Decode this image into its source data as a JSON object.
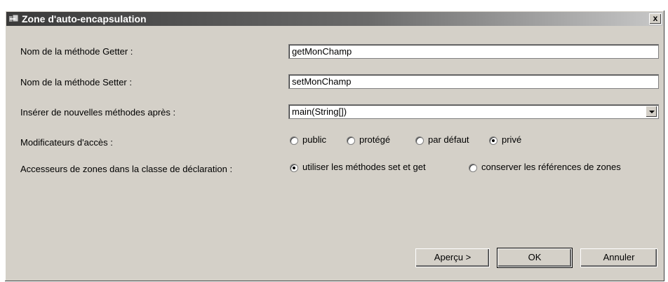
{
  "window": {
    "title": "Zone d'auto-encapsulation",
    "close_label": "x"
  },
  "form": {
    "getter_label": "Nom de la méthode Getter :",
    "getter_value": "getMonChamp",
    "setter_label": "Nom de la méthode Setter :",
    "setter_value": "setMonChamp",
    "insert_label": "Insérer de nouvelles méthodes après :",
    "insert_value": "main(String[])",
    "access_label": "Modificateurs d'accès :",
    "access_options": [
      "public",
      "protégé",
      "par défaut",
      "privé"
    ],
    "access_selected": "privé",
    "accessors_label": "Accesseurs de zones dans la classe de déclaration :",
    "accessors_options": [
      "utiliser les méthodes set et get",
      "conserver les références de zones"
    ],
    "accessors_selected": "utiliser les méthodes set et get"
  },
  "buttons": {
    "preview": "Aperçu >",
    "ok": "OK",
    "cancel": "Annuler"
  }
}
